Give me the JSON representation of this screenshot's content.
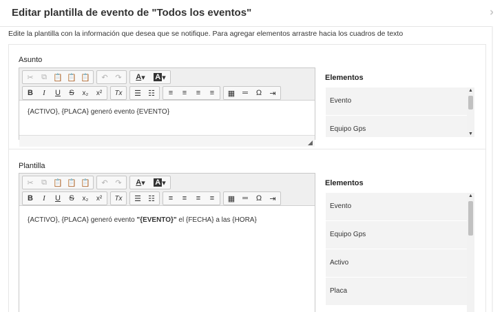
{
  "modal": {
    "title": "Editar plantilla de evento de \"Todos los eventos\"",
    "close_label": "×",
    "instructions": "Edite la plantilla con la información que desea que se notifique. Para agregar elementos arrastre hacia los cuadros de texto"
  },
  "asunto": {
    "label": "Asunto",
    "content": "{ACTIVO}, {PLACA} generó evento {EVENTO}"
  },
  "plantilla": {
    "label": "Plantilla",
    "content_before": "{ACTIVO}, {PLACA} generó evento ",
    "content_bold": "\"{EVENTO}\"",
    "content_after": " el  {FECHA} a las {HORA}"
  },
  "elements_panel": {
    "title": "Elementos",
    "items": [
      "Evento",
      "Equipo Gps",
      "Activo",
      "Placa"
    ]
  },
  "toolbar": {
    "font_color_label": "A",
    "bg_color_label": "A",
    "bold": "B",
    "italic": "I",
    "underline": "U",
    "strike": "S",
    "subscript": "x₂",
    "superscript": "x²",
    "remove_format": "Tx",
    "special_char": "Ω"
  }
}
